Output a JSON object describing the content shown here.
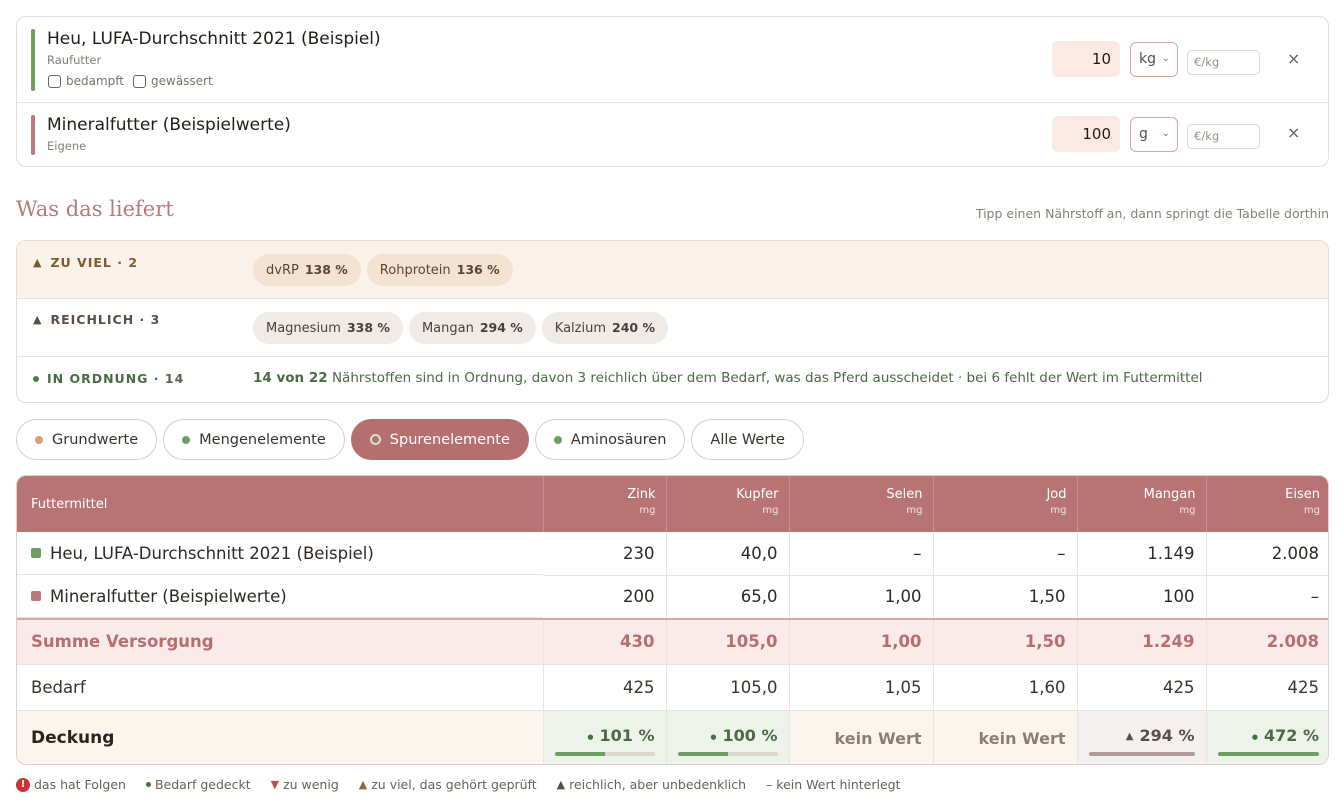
{
  "feeds": [
    {
      "name": "Heu, LUFA-Durchschnitt 2021 (Beispiel)",
      "category": "Raufutter",
      "options": [
        "bedampft",
        "gewässert"
      ],
      "quantity": "10",
      "unit": "kg",
      "price_placeholder": "€/kg",
      "remove": "×",
      "color": "#6f9e63"
    },
    {
      "name": "Mineralfutter (Beispielwerte)",
      "category": "Eigene",
      "quantity": "100",
      "unit": "g",
      "price_placeholder": "€/kg",
      "remove": "×",
      "color": "#c07878"
    }
  ],
  "section": {
    "title": "Was das liefert",
    "hint": "Tipp einen Nährstoff an, dann springt die Tabelle dorthin"
  },
  "status": {
    "too_much": {
      "label": "ZU VIEL · 2",
      "chips": [
        {
          "name": "dvRP",
          "value": "138 %"
        },
        {
          "name": "Rohprotein",
          "value": "136 %"
        }
      ]
    },
    "plenty": {
      "label": "REICHLICH · 3",
      "chips": [
        {
          "name": "Magnesium",
          "value": "338 %"
        },
        {
          "name": "Mangan",
          "value": "294 %"
        },
        {
          "name": "Kalzium",
          "value": "240 %"
        }
      ]
    },
    "ok": {
      "label": "IN ORDNUNG · 14",
      "count": "14 von 22",
      "text": " Nährstoffen sind in Ordnung, davon 3 reichlich über dem Bedarf, was das Pferd ausscheidet · bei 6 fehlt der Wert im Futtermittel"
    }
  },
  "tabs": [
    {
      "label": "Grundwerte",
      "dot": "#d4a373",
      "active": false
    },
    {
      "label": "Mengenelemente",
      "dot": "#6f9e63",
      "active": false
    },
    {
      "label": "Spurenelemente",
      "dot": "",
      "active": true
    },
    {
      "label": "Aminosäuren",
      "dot": "#6f9e63",
      "active": false
    },
    {
      "label": "Alle Werte",
      "dot": "",
      "active": false
    }
  ],
  "table": {
    "first_header": "Futtermittel",
    "columns": [
      {
        "name": "Zink",
        "unit": "mg"
      },
      {
        "name": "Kupfer",
        "unit": "mg"
      },
      {
        "name": "Selen",
        "unit": "mg"
      },
      {
        "name": "Jod",
        "unit": "mg"
      },
      {
        "name": "Mangan",
        "unit": "mg"
      },
      {
        "name": "Eisen",
        "unit": "mg"
      }
    ],
    "feed_rows": [
      {
        "name": "Heu, LUFA-Durchschnitt 2021 (Beispiel)",
        "color": "#6f9e63",
        "values": [
          "230",
          "40,0",
          "–",
          "–",
          "1.149",
          "2.008"
        ]
      },
      {
        "name": "Mineralfutter (Beispielwerte)",
        "color": "#c07878",
        "values": [
          "200",
          "65,0",
          "1,00",
          "1,50",
          "100",
          "–"
        ]
      }
    ],
    "sum_row": {
      "label": "Summe Versorgung",
      "values": [
        "430",
        "105,0",
        "1,00",
        "1,50",
        "1.249",
        "2.008"
      ]
    },
    "need_row": {
      "label": "Bedarf",
      "values": [
        "425",
        "105,0",
        "1,05",
        "1,60",
        "425",
        "425"
      ]
    },
    "coverage_row": {
      "label": "Deckung",
      "cells": [
        {
          "kind": "ok",
          "marker": "●",
          "value": "101 %",
          "fill": 0.5
        },
        {
          "kind": "ok",
          "marker": "●",
          "value": "100 %",
          "fill": 0.5
        },
        {
          "kind": "nv",
          "value": "kein Wert"
        },
        {
          "kind": "nv",
          "value": "kein Wert"
        },
        {
          "kind": "high",
          "marker": "▲",
          "value": "294 %",
          "fill": 1.0
        },
        {
          "kind": "ok",
          "marker": "●",
          "value": "472 %",
          "fill": 1.0
        }
      ]
    }
  },
  "legend": {
    "consequence": "das hat Folgen",
    "covered": "Bedarf gedeckt",
    "too_little": "zu wenig",
    "too_much": "zu viel, das gehört geprüft",
    "plenty": "reichlich, aber unbedenklich",
    "no_value": "– kein Wert hinterlegt"
  }
}
